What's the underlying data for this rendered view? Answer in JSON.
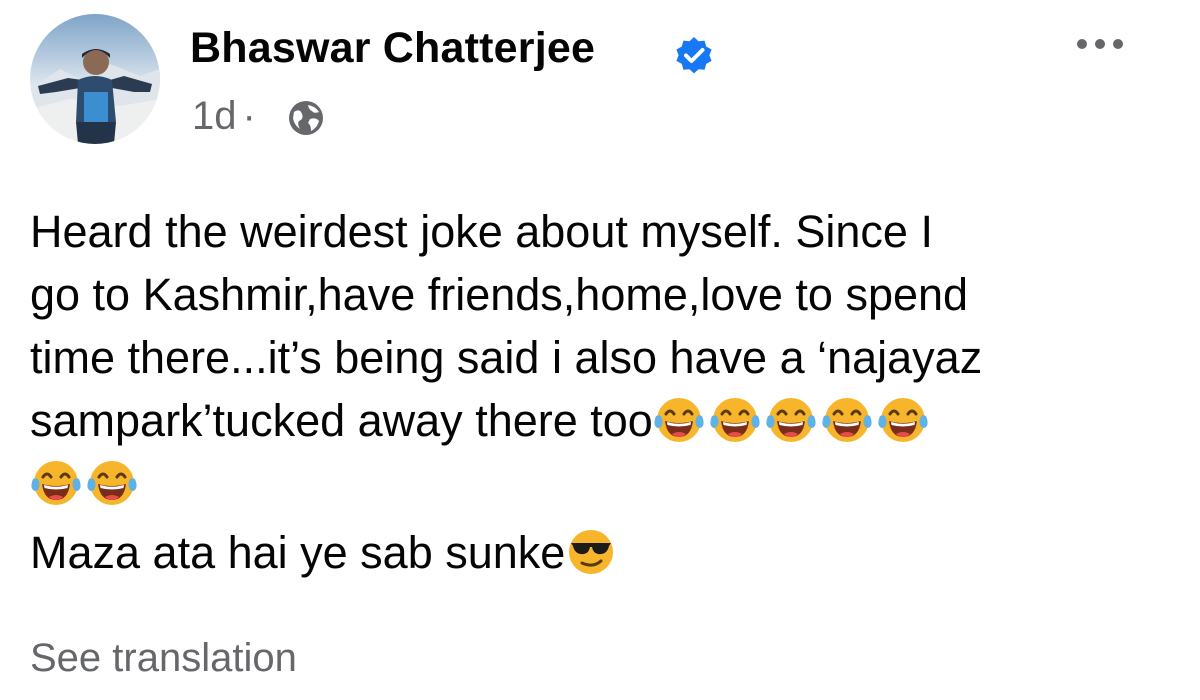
{
  "post": {
    "author_name": "Bhaswar Chatterjee",
    "timestamp": "1d",
    "separator": "·",
    "privacy_icon": "globe-icon",
    "verified_icon": "verified-badge-icon",
    "more_icon": "more-options-icon",
    "text_lines": [
      "Heard the weirdest joke about myself. Since I",
      "go to Kashmir,have friends,home,love to spend",
      "time there...it’s being said i also have a ‘najayaz",
      "sampark’tucked away there too"
    ],
    "emoji_line1_count": 5,
    "emoji_line2_count": 2,
    "emoji_tears": "face-with-tears-of-joy-emoji",
    "second_paragraph": "Maza ata hai ye sab sunke",
    "emoji_cool": "smiling-face-with-sunglasses-emoji",
    "see_translation": "See translation"
  },
  "colors": {
    "text": "#050505",
    "secondary": "#65676b",
    "verified_blue": "#1877f2",
    "emoji_yellow": "#f7b52b",
    "tear_blue": "#5fb2e6"
  }
}
